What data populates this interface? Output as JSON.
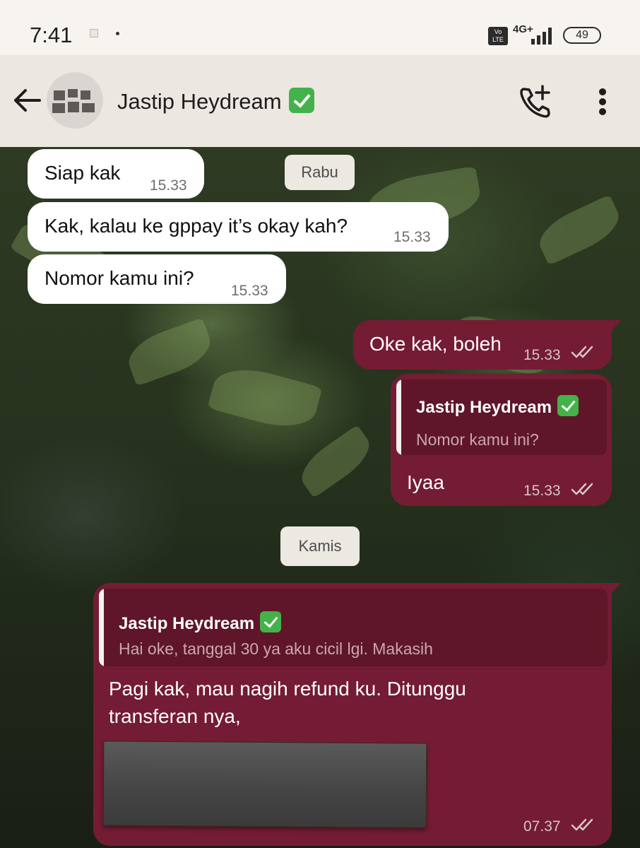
{
  "status_bar": {
    "time": "7:41",
    "network": "4G+",
    "volte": "Vo LTE",
    "battery": "49"
  },
  "header": {
    "contact_name": "Jastip Heydream",
    "back_icon": "arrow-left-icon",
    "call_icon": "add-call-icon",
    "menu_icon": "more-vert-icon"
  },
  "colors": {
    "outgoing_bubble": "#741c34",
    "incoming_bubble": "#ffffff",
    "header_bg": "#ece8e1",
    "verified": "#44b24a"
  },
  "messages": [
    {
      "direction": "in",
      "text": "Siap kak",
      "time": "15.33"
    },
    {
      "direction": "in",
      "text": "Kak, kalau ke gppay it’s okay kah?",
      "time": "15.33"
    },
    {
      "direction": "in",
      "text": "Nomor kamu ini?",
      "time": "15.33"
    },
    {
      "direction": "out",
      "text": "Oke kak, boleh",
      "time": "15.33",
      "status": "read"
    },
    {
      "direction": "out",
      "text": "Iyaa",
      "time": "15.33",
      "status": "read",
      "quote": {
        "name": "Jastip Heydream",
        "text": "Nomor kamu ini?"
      }
    },
    {
      "direction": "out",
      "line1": "Pagi kak, mau nagih refund ku. Ditunggu",
      "line2": "transferan nya,",
      "time": "07.37",
      "status": "read",
      "quote": {
        "name": "Jastip Heydream",
        "text": "Hai oke, tanggal 30 ya aku cicil lgi. Makasih"
      }
    }
  ],
  "date_chips": {
    "first": "Rabu",
    "second": "Kamis"
  }
}
